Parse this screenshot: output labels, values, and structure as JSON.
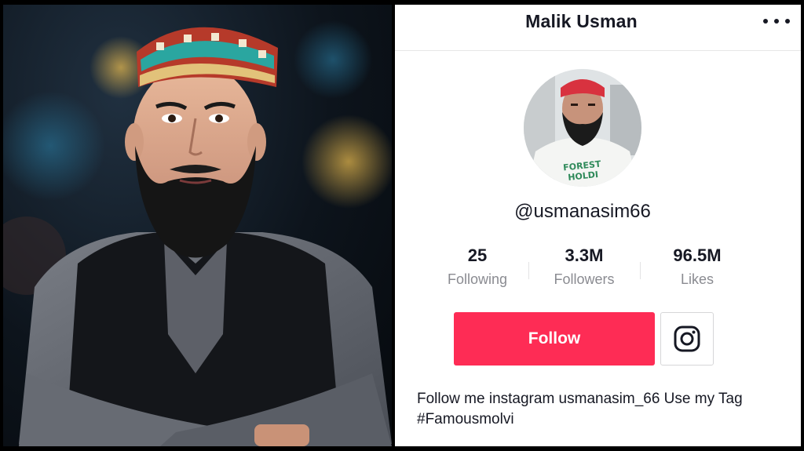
{
  "profile": {
    "display_name": "Malik Usman",
    "username": "@usmanasim66",
    "stats": [
      {
        "value": "25",
        "label": "Following"
      },
      {
        "value": "3.3M",
        "label": "Followers"
      },
      {
        "value": "96.5M",
        "label": "Likes"
      }
    ],
    "follow_label": "Follow",
    "bio": "Follow me instagram usmanasim_66 Use my Tag #Famousmolvi",
    "avatar_shirt_text": "FOREST HOLDI"
  },
  "icons": {
    "menu": "more-horizontal-icon",
    "instagram": "instagram-icon"
  },
  "colors": {
    "accent": "#fe2c55",
    "text": "#161823",
    "muted": "#8a8b91"
  }
}
